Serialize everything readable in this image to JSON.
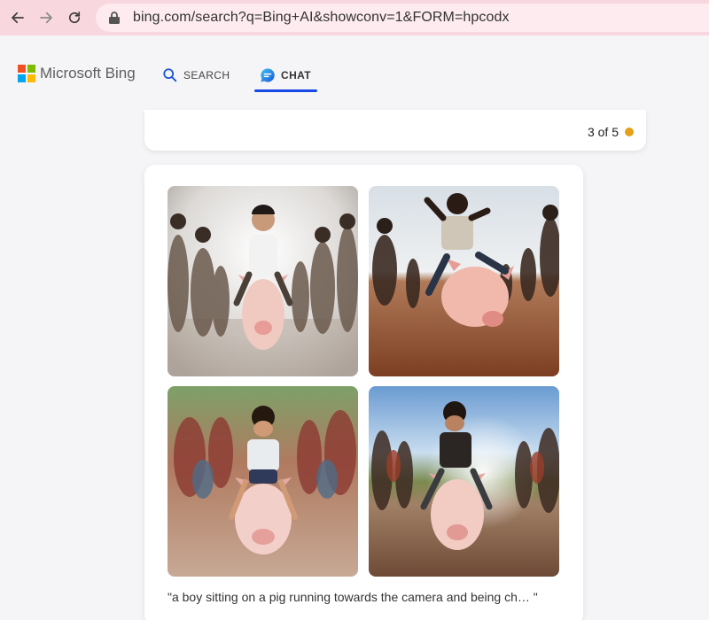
{
  "browser": {
    "url": "bing.com/search?q=Bing+AI&showconv=1&FORM=hpcodx"
  },
  "header": {
    "logo_text": "Microsoft Bing",
    "tabs": [
      {
        "label": "SEARCH",
        "icon": "search-icon"
      },
      {
        "label": "CHAT",
        "icon": "chat-icon",
        "active": true
      }
    ]
  },
  "counter": {
    "text": "3 of 5",
    "dot_color": "#e3a018"
  },
  "images": {
    "caption": "\"a boy sitting on a pig running towards the camera and being ch… \"",
    "tiles": [
      {
        "alt": "generated-image-1"
      },
      {
        "alt": "generated-image-2"
      },
      {
        "alt": "generated-image-3"
      },
      {
        "alt": "generated-image-4"
      }
    ]
  },
  "colors": {
    "chrome_bg": "#f8d7df",
    "accent": "#174ae4",
    "ms_red": "#f25022",
    "ms_green": "#7fba00",
    "ms_blue": "#00a4ef",
    "ms_yellow": "#ffb900"
  }
}
